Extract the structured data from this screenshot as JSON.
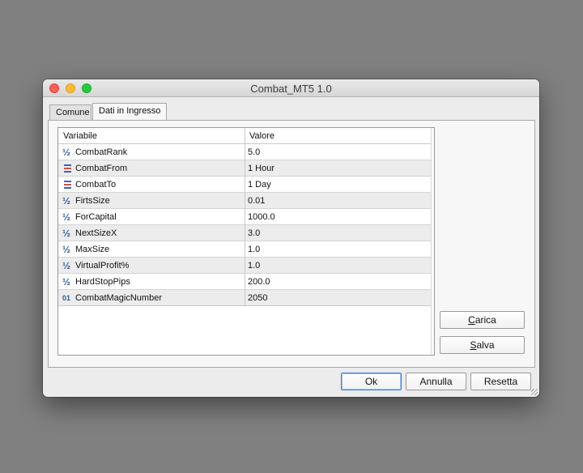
{
  "window": {
    "title": "Combat_MT5 1.0"
  },
  "tabs": [
    {
      "label": "Comune",
      "active": false
    },
    {
      "label": "Dati in Ingresso",
      "active": true
    }
  ],
  "table": {
    "headers": {
      "variable": "Variabile",
      "value": "Valore"
    },
    "rows": [
      {
        "icon": "fraction-icon",
        "name": "CombatRank",
        "value": "5.0"
      },
      {
        "icon": "enum-icon",
        "name": "CombatFrom",
        "value": "1 Hour"
      },
      {
        "icon": "enum-icon",
        "name": "CombatTo",
        "value": "1 Day"
      },
      {
        "icon": "fraction-icon",
        "name": "FirtsSize",
        "value": "0.01"
      },
      {
        "icon": "fraction-icon",
        "name": "ForCapital",
        "value": "1000.0"
      },
      {
        "icon": "fraction-icon",
        "name": "NextSizeX",
        "value": "3.0"
      },
      {
        "icon": "fraction-icon",
        "name": "MaxSize",
        "value": "1.0"
      },
      {
        "icon": "fraction-icon",
        "name": "VirtualProfit%",
        "value": "1.0"
      },
      {
        "icon": "fraction-icon",
        "name": "HardStopPips",
        "value": "200.0"
      },
      {
        "icon": "integer-icon",
        "name": "CombatMagicNumber",
        "value": "2050"
      }
    ]
  },
  "side_buttons": {
    "load_first": "C",
    "load_rest": "arica",
    "save_first": "S",
    "save_rest": "alva"
  },
  "footer_buttons": {
    "ok": "Ok",
    "cancel": "Annulla",
    "reset": "Resetta"
  },
  "icons": {
    "fraction_glyph": "½",
    "integer_glyph": "01"
  }
}
